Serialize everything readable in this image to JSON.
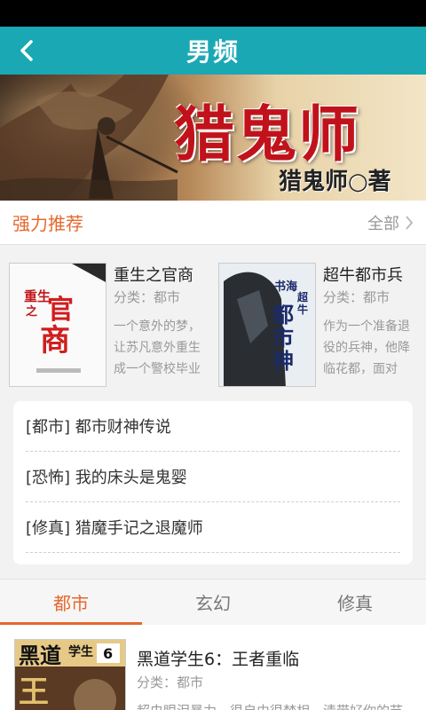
{
  "header": {
    "title": "男频",
    "back_icon": "back-arrow-icon",
    "bar_color": "#1aa8b4"
  },
  "banner": {
    "title": "猎鬼师",
    "author_line": "猎鬼师○著"
  },
  "recommend": {
    "title": "强力推荐",
    "more_label": "全部",
    "more_icon": "chevron-right-icon",
    "accent": "#e5692d",
    "books": [
      {
        "title": "重生之官商",
        "category": "分类：都市",
        "desc_lines": [
          "一个意外的梦，",
          "让苏凡意外重生",
          "成一个警校毕业"
        ]
      },
      {
        "title": "超牛都市兵",
        "category": "分类：都市",
        "desc_lines": [
          "作为一个准备退",
          "役的兵神，他降",
          "临花都，面对"
        ]
      }
    ]
  },
  "list": [
    {
      "text": "[都市] 都市财神传说"
    },
    {
      "text": "[恐怖] 我的床头是鬼婴"
    },
    {
      "text": "[修真] 猎魔手记之退魔师"
    }
  ],
  "tabs": [
    {
      "label": "都市",
      "active": true
    },
    {
      "label": "玄幻",
      "active": false
    },
    {
      "label": "修真",
      "active": false
    }
  ],
  "book_list": [
    {
      "title": "黑道学生6：王者重临",
      "category": "分类：都市",
      "desc": "超虫眼泪暴力，很自由很焚相，清带好你的节"
    }
  ]
}
